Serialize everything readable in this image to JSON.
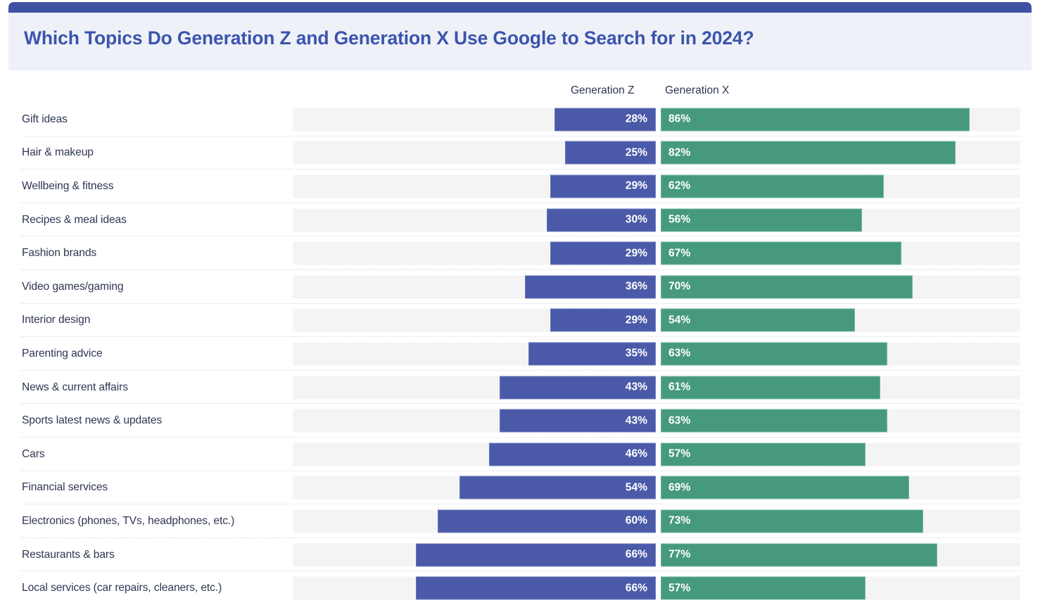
{
  "header": {
    "title": "Which Topics Do Generation Z and Generation X Use Google to Search for in 2024?",
    "accent_color": "#3f51a3",
    "background_color": "#eef1f8",
    "title_color": "#3b54ad"
  },
  "legend": {
    "series_1_label": "Generation Z",
    "series_2_label": "Generation X",
    "series_1_color": "#4a5aa8",
    "series_2_color": "#46997f"
  },
  "chart_data": {
    "type": "bar",
    "title": "Which Topics Do Generation Z and Generation X Use Google to Search for in 2024?",
    "xlabel": "",
    "ylabel": "",
    "xlim": [
      0,
      100
    ],
    "unit": "%",
    "orientation": "horizontal",
    "grid": false,
    "legend_position": "top",
    "categories": [
      "Gift ideas",
      "Hair & makeup",
      "Wellbeing & fitness",
      "Recipes & meal ideas",
      "Fashion brands",
      "Video games/gaming",
      "Interior design",
      "Parenting advice",
      "News & current affairs",
      "Sports latest news & updates",
      "Cars",
      "Financial services",
      "Electronics (phones, TVs, headphones, etc.)",
      "Restaurants & bars",
      "Local services (car repairs, cleaners, etc.)"
    ],
    "series": [
      {
        "name": "Generation Z",
        "color": "#4a5aa8",
        "values": [
          28,
          25,
          29,
          30,
          29,
          36,
          29,
          35,
          43,
          43,
          46,
          54,
          60,
          66,
          66
        ],
        "labels": [
          "28%",
          "25%",
          "29%",
          "30%",
          "29%",
          "36%",
          "29%",
          "35%",
          "43%",
          "43%",
          "46%",
          "54%",
          "60%",
          "66%",
          "66%"
        ]
      },
      {
        "name": "Generation X",
        "color": "#46997f",
        "values": [
          86,
          82,
          62,
          56,
          67,
          70,
          54,
          63,
          61,
          63,
          57,
          69,
          73,
          77,
          57
        ],
        "labels": [
          "86%",
          "82%",
          "62%",
          "56%",
          "67%",
          "70%",
          "54%",
          "63%",
          "61%",
          "63%",
          "57%",
          "69%",
          "73%",
          "77%",
          "57%"
        ]
      }
    ]
  }
}
